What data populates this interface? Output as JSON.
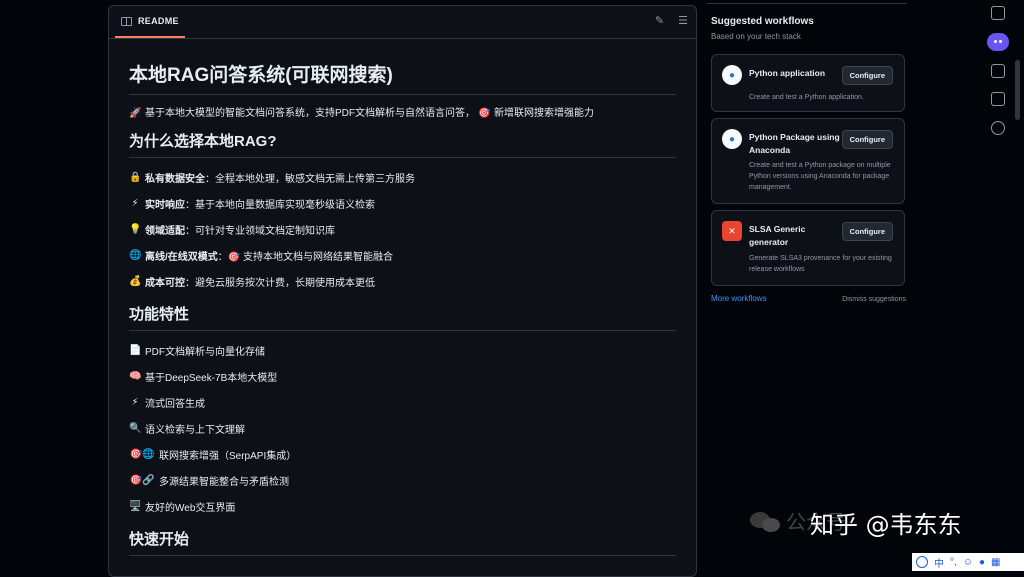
{
  "readme": {
    "tab_label": "README",
    "title": "本地RAG问答系统(可联网搜索)",
    "lead_emoji": "🚀",
    "lead_text": "基于本地大模型的智能文档问答系统，支持PDF文档解析与自然语言问答，",
    "lead_emoji2": "🎯",
    "lead_text2": "新增联网搜索增强能力",
    "why": {
      "heading": "为什么选择本地RAG?",
      "items": [
        {
          "emoji": "🔒",
          "bold": "私有数据安全",
          "text": "：全程本地处理，敏感文档无需上传第三方服务"
        },
        {
          "emoji": "⚡",
          "bold": "实时响应",
          "text": "：基于本地向量数据库实现毫秒级语义检索"
        },
        {
          "emoji": "💡",
          "bold": "领域适配",
          "text": "：可针对专业领域文档定制知识库"
        },
        {
          "emoji": "🌐",
          "bold": "离线/在线双模式",
          "text": "：🎯 支持本地文档与网络结果智能融合"
        },
        {
          "emoji": "💰",
          "bold": "成本可控",
          "text": "：避免云服务按次计费，长期使用成本更低"
        }
      ]
    },
    "features": {
      "heading": "功能特性",
      "items": [
        {
          "emoji": "📄",
          "text": "PDF文档解析与向量化存储"
        },
        {
          "emoji": "🧠",
          "text": "基于DeepSeek-7B本地大模型"
        },
        {
          "emoji": "⚡",
          "text": "流式回答生成"
        },
        {
          "emoji": "🔍",
          "text": "语义检索与上下文理解"
        },
        {
          "emoji": "🎯🌐",
          "text": "联网搜索增强（SerpAPI集成）"
        },
        {
          "emoji": "🎯🔗",
          "text": "多源结果智能整合与矛盾检测"
        },
        {
          "emoji": "🖥️",
          "text": "友好的Web交互界面"
        }
      ]
    },
    "quickstart_heading": "快速开始"
  },
  "sidebar": {
    "title": "Suggested workflows",
    "subtitle": "Based on your tech stack",
    "cards": [
      {
        "name": "Python application",
        "desc": "Create and test a Python application.",
        "button": "Configure",
        "icon": "python-logo"
      },
      {
        "name": "Python Package using Anaconda",
        "desc": "Create and test a Python package on multiple Python versions using Anaconda for package management.",
        "button": "Configure",
        "icon": "python-logo"
      },
      {
        "name": "SLSA Generic generator",
        "desc": "Generate SLSA3 provenance for your existing release workflows",
        "button": "Configure",
        "icon": "slsa-logo"
      }
    ],
    "more_link": "More workflows",
    "dismiss": "Dismiss suggestions"
  },
  "watermark": {
    "ghost": "公众号",
    "text": "知乎 @韦东东"
  },
  "ime_bar": {
    "lang": "中"
  },
  "colors": {
    "background": "#010409",
    "panel": "#0d1117",
    "border": "#30363d",
    "tab_underline": "#f78166",
    "link": "#4493f8",
    "copilot": "#6b56f5"
  }
}
